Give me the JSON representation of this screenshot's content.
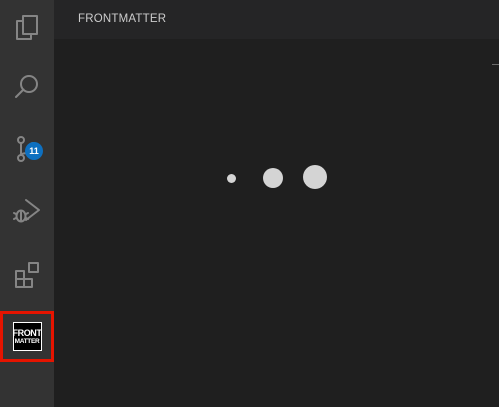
{
  "activity_bar": {
    "items": [
      {
        "icon": "files-icon"
      },
      {
        "icon": "search-icon"
      },
      {
        "icon": "source-control-icon",
        "badge": "11"
      },
      {
        "icon": "run-debug-icon"
      },
      {
        "icon": "extensions-icon"
      },
      {
        "icon": "frontmatter-icon",
        "logo_line1": "FRONT",
        "logo_line2": "MATTER",
        "active": true
      }
    ]
  },
  "sidebar": {
    "title": "FRONTMATTER",
    "loading": true
  },
  "colors": {
    "activity_bar_bg": "#333333",
    "sidebar_bg": "#252526",
    "icon_color": "#858585",
    "badge_bg": "#0e70c0",
    "highlight_border": "#e51400",
    "loader_dot": "#d4d4d4"
  }
}
